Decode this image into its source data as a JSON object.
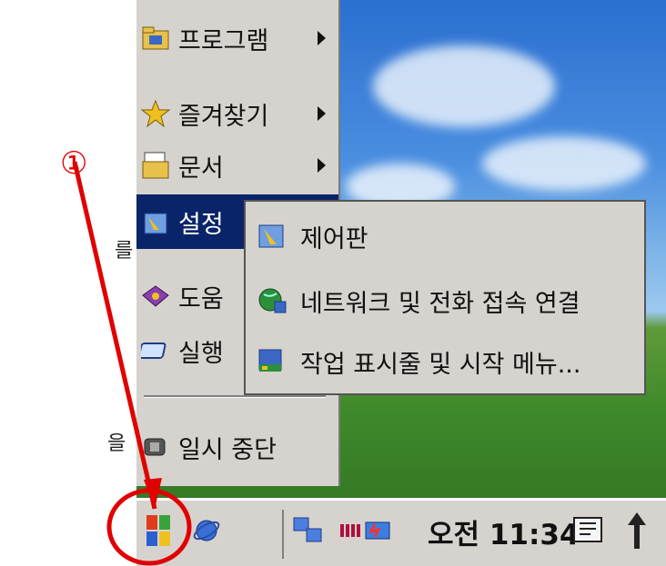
{
  "start_menu": {
    "items": [
      {
        "label": "프로그램",
        "icon": "programs-folder-icon",
        "has_submenu": true,
        "selected": false
      },
      {
        "label": "즐겨찾기",
        "icon": "favorites-star-icon",
        "has_submenu": true,
        "selected": false
      },
      {
        "label": "문서",
        "icon": "documents-icon",
        "has_submenu": true,
        "selected": false
      },
      {
        "label": "설정",
        "icon": "settings-folder-icon",
        "has_submenu": true,
        "selected": true
      },
      {
        "label": "도움",
        "icon": "help-book-icon",
        "has_submenu": false,
        "selected": false
      },
      {
        "label": "실행",
        "icon": "run-icon",
        "has_submenu": false,
        "selected": false
      },
      {
        "label": "일시 중단",
        "icon": "suspend-icon",
        "has_submenu": false,
        "selected": false
      }
    ]
  },
  "settings_submenu": {
    "items": [
      {
        "label": "제어판",
        "icon": "control-panel-icon"
      },
      {
        "label": "네트워크 및 전화 접속 연결",
        "icon": "network-globe-icon"
      },
      {
        "label": "작업 표시줄 및 시작 메뉴...",
        "icon": "taskbar-icon"
      }
    ]
  },
  "taskbar": {
    "clock": "오전 11:34",
    "icons": [
      "start-windows-icon",
      "ie-browser-icon",
      "network-status-icon",
      "battery-icon",
      "input-method-icon",
      "up-arrow-icon"
    ]
  },
  "annotation": {
    "marker": "①",
    "color": "#e00000"
  },
  "left_margin_text": {
    "char_top": "를",
    "char_bottom": "을"
  },
  "colors": {
    "menu_bg": "#d6d3ce",
    "selection": "#0a246a",
    "annotation": "#e00000"
  }
}
